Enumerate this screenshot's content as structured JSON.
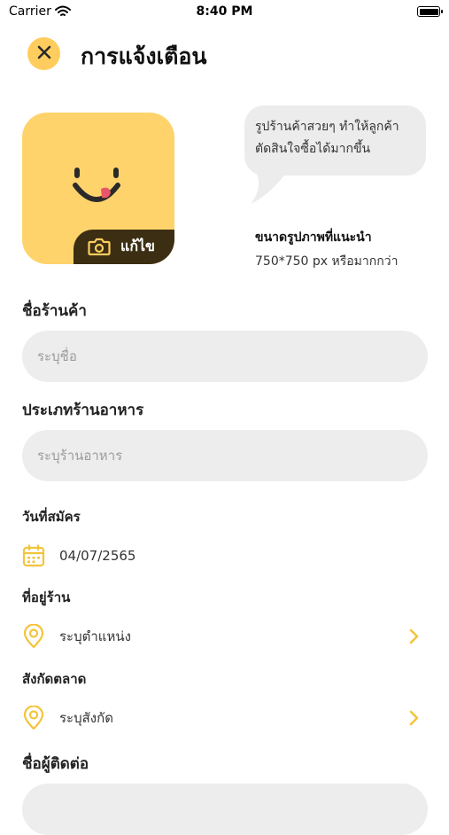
{
  "status_bar": {
    "carrier": "Carrier",
    "time": "8:40 PM"
  },
  "header": {
    "title": "การแจ้งเตือน"
  },
  "avatar": {
    "edit_label": "แก้ไข"
  },
  "bubble": {
    "line1": "รูปร้านค้าสวยๆ ทำให้ลูกค้า",
    "line2": "ตัดสินใจซื้อได้มากขึ้น"
  },
  "recommend": {
    "title": "ขนาดรูปภาพที่แนะนำ",
    "size": "750*750 px หรือมากกว่า"
  },
  "form": {
    "shop_name": {
      "label": "ชื่อร้านค้า",
      "placeholder": "ระบุชื่อ"
    },
    "restaurant_type": {
      "label": "ประเภทร้านอาหาร",
      "placeholder": "ระบุร้านอาหาร"
    },
    "register_date": {
      "label": "วันที่สมัคร",
      "value": "04/07/2565"
    },
    "address": {
      "label": "ที่อยู่ร้าน",
      "placeholder": "ระบุตำแหน่ง"
    },
    "market": {
      "label": "สังกัดตลาด",
      "placeholder": "ระบุสังกัด"
    },
    "contact_name": {
      "label": "ชื่อผู้ติดต่อ"
    }
  },
  "icons": {
    "close": "close-icon",
    "wifi": "wifi-icon",
    "camera": "camera-icon",
    "calendar": "calendar-icon",
    "pin": "location-pin-icon",
    "chevron": "chevron-right-icon"
  },
  "colors": {
    "accent": "#ffcd5e",
    "avatar_bg": "#ffd36b",
    "edit_bg": "#3c2e12",
    "field_bg": "#ededed",
    "icon_yellow": "#f4c43a"
  }
}
